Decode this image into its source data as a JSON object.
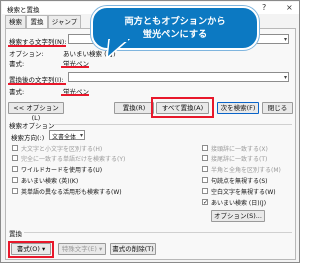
{
  "window": {
    "title": "検索と置換",
    "help_glyph": "?",
    "close_glyph": "×"
  },
  "tabs": [
    {
      "label": "検索"
    },
    {
      "label": "置換"
    },
    {
      "label": "ジャンプ"
    }
  ],
  "search": {
    "label": "検索する文字列(N):",
    "value": "",
    "options_label": "オプション:",
    "options_value": "あいまい検索 (日)",
    "format_label": "書式:",
    "format_value": "蛍光ペン"
  },
  "replace": {
    "label": "置換後の文字列(I):",
    "value": "",
    "format_label": "書式:",
    "format_value": "蛍光ペン"
  },
  "buttons": {
    "options_toggle": "<< オプション(L)",
    "replace": "置換(R)",
    "replace_all": "すべて置換(A)",
    "find_next": "次を検索(F)",
    "cancel": "閉じる"
  },
  "search_options": {
    "heading": "検索オプション",
    "direction_label": "検索方向(:)",
    "direction_value": "文書全体",
    "left": [
      {
        "label": "大文字と小文字を区別する(H)",
        "checked": false,
        "disabled": true
      },
      {
        "label": "完全に一致する単語だけを検索する(Y)",
        "checked": false,
        "disabled": true
      },
      {
        "label": "ワイルドカードを使用する(U)",
        "checked": false,
        "disabled": false
      },
      {
        "label": "あいまい検索 (英)(K)",
        "checked": false,
        "disabled": false
      },
      {
        "label": "英単語の異なる活用形も検索する(W)",
        "checked": false,
        "disabled": false
      }
    ],
    "right": [
      {
        "label": "接頭辞に一致する(X)",
        "checked": false,
        "disabled": true
      },
      {
        "label": "接尾辞に一致する(T)",
        "checked": false,
        "disabled": true
      },
      {
        "label": "半角と全角を区別する(M)",
        "checked": false,
        "disabled": true
      },
      {
        "label": "句読点を無視する(S)",
        "checked": false,
        "disabled": false
      },
      {
        "label": "空白文字を無視する(W)",
        "checked": false,
        "disabled": false
      },
      {
        "label": "あいまい検索 (日)(J)",
        "checked": true,
        "disabled": false
      }
    ],
    "options_button": "オプション(S)..."
  },
  "replace_section": {
    "heading": "置換",
    "format_button": "書式(O) ▾",
    "special_button": "特殊文字(E) ▾",
    "clear_format_button": "書式の削除(T)"
  },
  "callout": {
    "text": "両方ともオプションから\n蛍光ペンにする"
  },
  "colors": {
    "accent_red": "#e8182b",
    "callout_blue": "#0c79c2"
  }
}
